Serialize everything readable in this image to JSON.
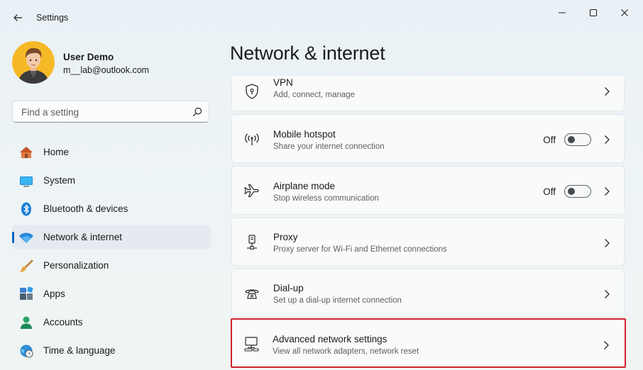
{
  "window": {
    "title": "Settings"
  },
  "user": {
    "name": "User Demo",
    "email": "m__lab@outlook.com"
  },
  "search": {
    "placeholder": "Find a setting",
    "value": ""
  },
  "sidebar": {
    "items": [
      {
        "label": "Home",
        "icon": "home-icon",
        "selected": false
      },
      {
        "label": "System",
        "icon": "monitor-icon",
        "selected": false
      },
      {
        "label": "Bluetooth & devices",
        "icon": "bluetooth-icon",
        "selected": false
      },
      {
        "label": "Network & internet",
        "icon": "wifi-icon",
        "selected": true
      },
      {
        "label": "Personalization",
        "icon": "brush-icon",
        "selected": false
      },
      {
        "label": "Apps",
        "icon": "apps-icon",
        "selected": false
      },
      {
        "label": "Accounts",
        "icon": "account-icon",
        "selected": false
      },
      {
        "label": "Time & language",
        "icon": "globe-clock-icon",
        "selected": false
      }
    ]
  },
  "main": {
    "title": "Network & internet",
    "cards": [
      {
        "title": "VPN",
        "description": "Add, connect, manage",
        "icon": "shield-icon"
      },
      {
        "title": "Mobile hotspot",
        "description": "Share your internet connection",
        "icon": "hotspot-icon",
        "toggle": "Off"
      },
      {
        "title": "Airplane mode",
        "description": "Stop wireless communication",
        "icon": "airplane-icon",
        "toggle": "Off"
      },
      {
        "title": "Proxy",
        "description": "Proxy server for Wi-Fi and Ethernet connections",
        "icon": "proxy-icon"
      },
      {
        "title": "Dial-up",
        "description": "Set up a dial-up internet connection",
        "icon": "dialup-icon"
      },
      {
        "title": "Advanced network settings",
        "description": "View all network adapters, network reset",
        "icon": "network-computer-icon",
        "highlighted": true
      }
    ]
  },
  "colors": {
    "accent": "#0067c0",
    "highlight_border": "#d2222d"
  }
}
